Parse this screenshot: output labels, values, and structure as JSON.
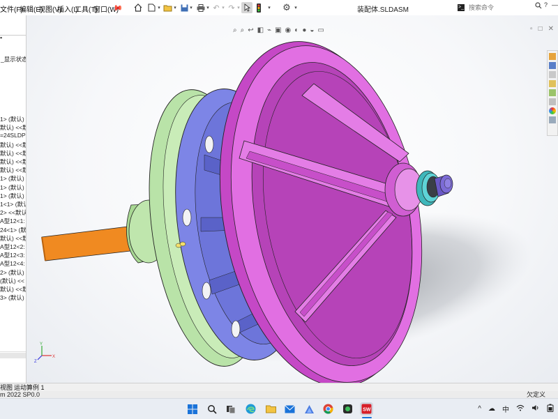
{
  "menu": {
    "file": "文件(F)",
    "edit": "编辑(E)",
    "view": "视图(V)",
    "insert": "插入(I)",
    "tools": "工具(T)",
    "window": "窗口(W)"
  },
  "document_title": "装配体.SLDASM",
  "search": {
    "placeholder": "搜索命令"
  },
  "tree": {
    "display_state": "_显示状态",
    "items": [
      "1> (默认)",
      "默认) <<默",
      "=24SLDP",
      "默认) <<默",
      "默认) <<默",
      "默认) <<默",
      "默认) <<默",
      "1> (默认)",
      "1> (默认)",
      "1> (默认)",
      "1<1> (默认",
      "2> <<默认>",
      "A型12<1:",
      "24<1> (默",
      "默认) <<默",
      "A型12<2:",
      "A型12<3:",
      "A型12<4:",
      "2> (默认)",
      "(默认) <<",
      "默认) <<默",
      "3> (默认)"
    ]
  },
  "bottom_tabs": {
    "model_view": "视图",
    "motion_study": "运动算例 1"
  },
  "status": {
    "version": "m 2022 SP0.0",
    "definition": "欠定义"
  },
  "tray": {
    "chevron": "^",
    "ime": "中"
  },
  "icons": {
    "taskbar": [
      "windows-start-icon",
      "search-icon",
      "task-view-icon",
      "edge-icon",
      "mail-icon",
      "store-icon",
      "chrome-icon",
      "app-icon",
      "solidworks-icon"
    ]
  },
  "colors": {
    "flywheel": "#d857d8",
    "housing": "#7d85e6",
    "flange": "#b9e3a8",
    "shaft": "#f08a21",
    "nut": "#7c6bd6",
    "bearing": "#5ed3d6"
  }
}
